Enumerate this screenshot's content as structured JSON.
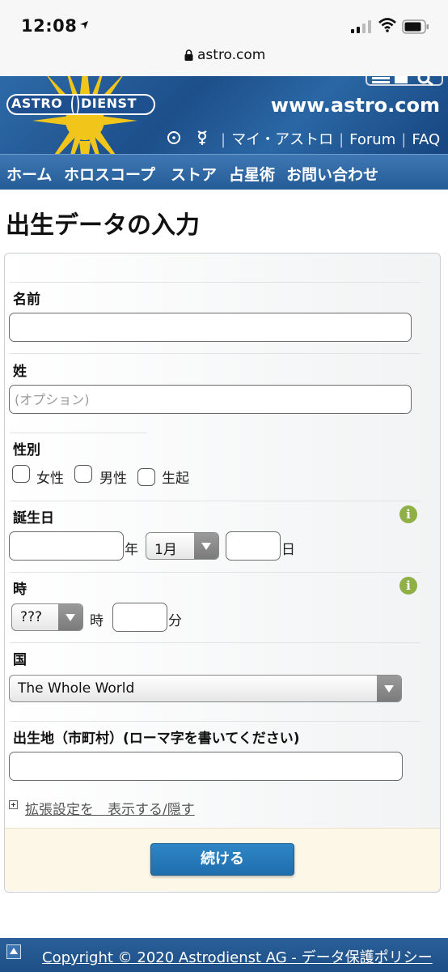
{
  "status_bar": {
    "time": "12:08"
  },
  "browser": {
    "url": "astro.com"
  },
  "header": {
    "logo_left": "ASTRO",
    "logo_right": "DIENST",
    "site_url": "www.astro.com",
    "top_links": [
      {
        "label": "マイ・アストロ"
      },
      {
        "label": "Forum"
      },
      {
        "label": "FAQ"
      }
    ]
  },
  "nav": {
    "items": [
      {
        "label": "ホーム"
      },
      {
        "label": "ホロスコープ"
      },
      {
        "label": "ストア"
      },
      {
        "label": "占星術"
      },
      {
        "label": "お問い合わせ"
      }
    ]
  },
  "page": {
    "title": "出生データの入力"
  },
  "form": {
    "first_name": {
      "label": "名前",
      "value": "",
      "placeholder": ""
    },
    "last_name": {
      "label": "姓",
      "value": "",
      "placeholder": "(オプション)"
    },
    "gender": {
      "label": "性別",
      "options": [
        {
          "label": "女性",
          "checked": false
        },
        {
          "label": "男性",
          "checked": false
        },
        {
          "label": "生起",
          "checked": false
        }
      ]
    },
    "birth_date": {
      "label": "誕生日",
      "year_value": "",
      "year_unit": "年",
      "month_value": "1月",
      "day_value": "",
      "day_unit": "日"
    },
    "birth_time": {
      "label": "時",
      "hour_value": "???",
      "hour_unit": "時",
      "minute_value": "",
      "minute_unit": "分"
    },
    "country": {
      "label": "国",
      "value": "The Whole World"
    },
    "birthplace": {
      "label": "出生地（市町村）(ローマ字を書いてください)",
      "value": ""
    },
    "advanced_link": "拡張設定を　表示する/隠す",
    "submit_label": "続ける",
    "info_icon_glyph": "i"
  },
  "footer": {
    "copyright": "Copyright © 2020 Astrodienst AG - データ保護ポリシー"
  },
  "colors": {
    "header_blue": "#1d4f8a",
    "nav_blue": "#245c98",
    "button_blue": "#1f6ead",
    "info_green": "#8fb046",
    "submit_area": "#fdf7e8"
  }
}
